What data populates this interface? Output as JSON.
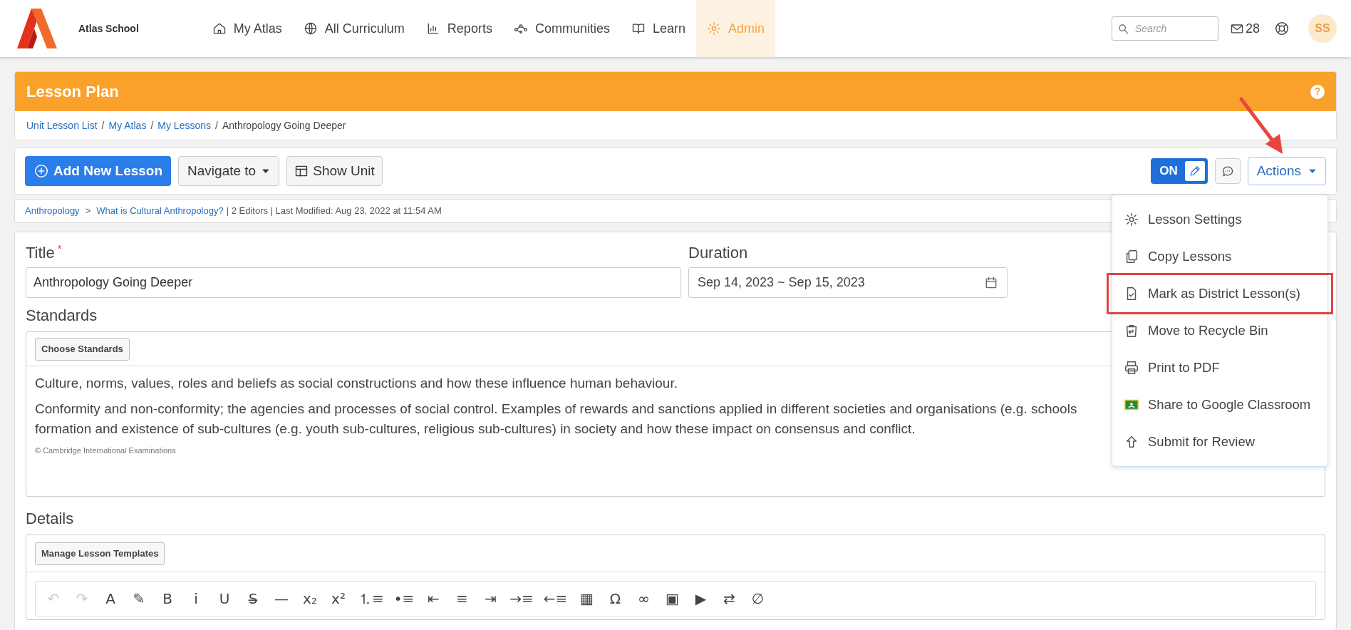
{
  "nav": {
    "school": "Atlas School",
    "items": [
      {
        "label": "My Atlas",
        "selected": false
      },
      {
        "label": "All Curriculum",
        "selected": false
      },
      {
        "label": "Reports",
        "selected": false
      },
      {
        "label": "Communities",
        "selected": false
      },
      {
        "label": "Learn",
        "selected": false
      },
      {
        "label": "Admin",
        "selected": true
      }
    ],
    "search": {
      "placeholder": "Search"
    },
    "mail_count": "28",
    "avatar": "SS"
  },
  "header": {
    "title": "Lesson Plan",
    "help": "?"
  },
  "breadcrumb": {
    "separator": "/",
    "items": [
      {
        "label": "Unit Lesson List",
        "link": true
      },
      {
        "label": "My Atlas",
        "link": true
      },
      {
        "label": "My Lessons",
        "link": true
      },
      {
        "label": "Anthropology Going Deeper",
        "link": false
      }
    ]
  },
  "toolbar": {
    "add": "Add New Lesson",
    "navigate": "Navigate to",
    "show_unit": "Show Unit",
    "edit_toggle": {
      "label": "ON",
      "on": true
    },
    "actions": "Actions"
  },
  "info": {
    "separator": ">",
    "path": [
      "Anthropology",
      "What is Cultural Anthropology?"
    ],
    "meta": "| 2 Editors | Last Modified: Aug 23, 2022 at 11:54 AM"
  },
  "form": {
    "title_label": "Title",
    "required_mark": "*",
    "title_value": "Anthropology Going Deeper",
    "duration_label": "Duration",
    "duration_value": "Sep 14, 2023 ~ Sep 15, 2023",
    "standards_label": "Standards",
    "choose_standards": "Choose Standards",
    "standards": [
      [
        "Culture, norms, values, roles and beliefs as social constructions and how these influence human behaviour."
      ],
      [
        "Conformity and non-conformity; the agencies and processes of social control. Examples of rewards and sanctions applied in different societies and organisations (e.g. schools",
        "formation and existence of sub-cultures (e.g. youth sub-cultures, religious sub-cultures) in society and how these impact on consensus and conflict."
      ]
    ],
    "copyright": "© Cambridge International Examinations",
    "details_label": "Details",
    "manage_templates": "Manage Lesson Templates"
  },
  "editor_toolbar": [
    {
      "text": "↶",
      "disabled": true
    },
    {
      "text": "↷",
      "disabled": true
    },
    {
      "text": "A",
      "disabled": false
    },
    {
      "text": "✎",
      "disabled": false
    },
    {
      "text": "B",
      "disabled": false
    },
    {
      "text": "i",
      "disabled": false
    },
    {
      "text": "U",
      "disabled": false
    },
    {
      "text": "S̶",
      "disabled": false
    },
    {
      "text": "—",
      "disabled": false
    },
    {
      "text": "x₂",
      "disabled": false
    },
    {
      "text": "x²",
      "disabled": false
    },
    {
      "text": "⒈≡",
      "disabled": false
    },
    {
      "text": "•≡",
      "disabled": false
    },
    {
      "text": "⇤",
      "disabled": false
    },
    {
      "text": "≡",
      "disabled": false
    },
    {
      "text": "⇥",
      "disabled": false
    },
    {
      "text": "→≡",
      "disabled": false
    },
    {
      "text": "←≡",
      "disabled": false
    },
    {
      "text": "▦",
      "disabled": false
    },
    {
      "text": "Ω",
      "disabled": false
    },
    {
      "text": "∞",
      "disabled": false
    },
    {
      "text": "▣",
      "disabled": false
    },
    {
      "text": "▶",
      "disabled": false
    },
    {
      "text": "⇄",
      "disabled": false
    },
    {
      "text": "∅",
      "disabled": false
    }
  ],
  "actions_menu": [
    {
      "label": "Lesson Settings",
      "highlighted": false
    },
    {
      "label": "Copy Lessons",
      "highlighted": false
    },
    {
      "label": "Mark as District Lesson(s)",
      "highlighted": true
    },
    {
      "label": "Move to Recycle Bin",
      "highlighted": false
    },
    {
      "label": "Print to PDF",
      "highlighted": false
    },
    {
      "label": "Share to Google Classroom",
      "highlighted": false
    },
    {
      "label": "Submit for Review",
      "highlighted": false
    }
  ]
}
